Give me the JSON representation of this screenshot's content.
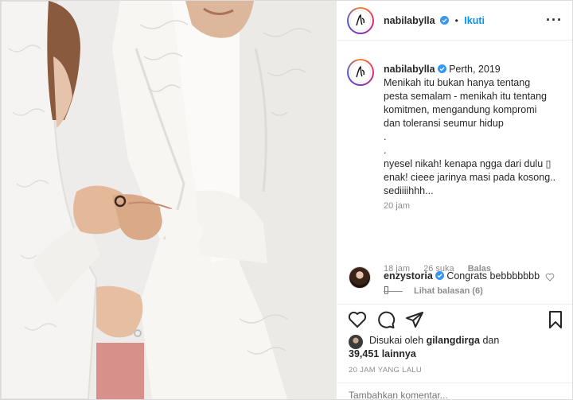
{
  "post": {
    "username": "nabilabylla",
    "follow_label": "Ikuti",
    "separator": "•",
    "more_label": "···",
    "caption": {
      "username": "nabilabylla",
      "location": "Perth, 2019",
      "lines": [
        "Menikah itu bukan hanya tentang",
        "pesta semalam - menikah itu tentang",
        "komitmen, mengandung kompromi",
        "dan toleransi seumur hidup",
        ".",
        ".",
        "nyesel nikah! kenapa ngga dari dulu ▯",
        "enak! cieee jarinya masi pada kosong..",
        "sediiiihhh..."
      ],
      "age": "20 jam"
    },
    "comment": {
      "username": "enzystoria",
      "text": "Congrats bebbbbbbb",
      "text2": "▯",
      "age": "18 jam",
      "likes": "26 suka",
      "reply_label": "Balas",
      "view_replies": "Lihat balasan (6)"
    },
    "likes": {
      "prefix": "Disukai oleh",
      "user": "gilangdirga",
      "joiner": "dan",
      "count": "39,451 lainnya"
    },
    "timestamp": "20 JAM YANG LALU",
    "add_comment_placeholder": "Tambahkan komentar..."
  },
  "icons": {
    "heart": "heart-icon",
    "comment": "comment-icon",
    "share": "share-icon",
    "save": "bookmark-icon",
    "verified": "verified-badge-icon"
  },
  "colors": {
    "accent": "#0095f6",
    "muted": "#8e8e8e",
    "text": "#262626"
  }
}
